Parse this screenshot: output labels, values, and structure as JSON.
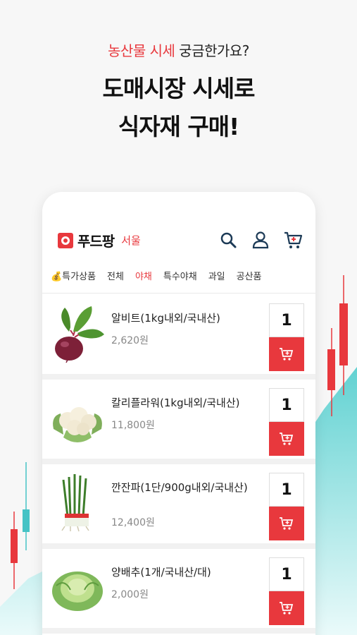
{
  "headline": {
    "sub_accent": "농산물 시세",
    "sub_rest": " 궁금한가요?",
    "line1": "도매시장 시세로",
    "line2": "식자재 구매!"
  },
  "app": {
    "brand": "푸드팡",
    "region": "서울",
    "icons": [
      "search-icon",
      "user-icon",
      "cart-icon"
    ]
  },
  "tabs": [
    {
      "label": "💰특가상품"
    },
    {
      "label": "전체"
    },
    {
      "label": "야채",
      "active": true
    },
    {
      "label": "특수야채"
    },
    {
      "label": "과일"
    },
    {
      "label": "공산품"
    }
  ],
  "products": [
    {
      "name": "알비트(1kg내외/국내산)",
      "price": "2,620원",
      "qty": "1",
      "image": "beet"
    },
    {
      "name": "칼리플라워(1kg내외/국내산)",
      "price": "11,800원",
      "qty": "1",
      "image": "cauliflower"
    },
    {
      "name": "깐잔파(1단/900g내외/국내산)",
      "price": "12,400원",
      "qty": "1",
      "image": "green-onion"
    },
    {
      "name": "양배추(1개/국내산/대)",
      "price": "2,000원",
      "qty": "1",
      "image": "cabbage"
    }
  ],
  "colors": {
    "accent": "#e8383d",
    "teal": "#5fd0d0"
  }
}
